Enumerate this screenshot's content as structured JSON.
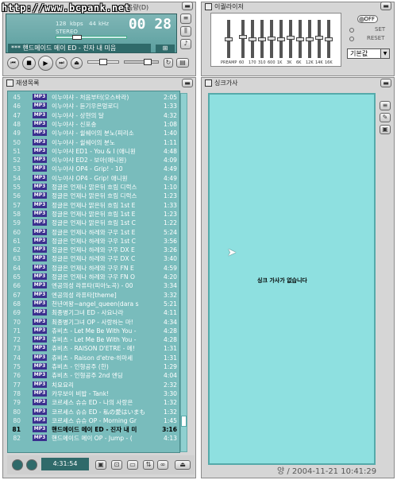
{
  "watermark": "http://www.bcpank.net",
  "player": {
    "title_suffix": "음량(D)",
    "bitrate": "128",
    "bitrate_unit": "kbps",
    "freq": "44",
    "freq_unit": "kHz",
    "mode": "STEREO",
    "time": "00 28",
    "track": "*** 핸드메이드 메이 ED - 진자 내 미음"
  },
  "eq": {
    "title": "이퀄라이저",
    "off_label": "OFF",
    "set_label": "SET",
    "reset_label": "RESET",
    "preset": "기본값",
    "preamp_label": "PREAMP",
    "bands": [
      "60",
      "170",
      "310",
      "600",
      "1K",
      "3K",
      "6K",
      "12K",
      "14K",
      "16K"
    ],
    "levels": [
      0.5,
      0.45,
      0.5,
      0.52,
      0.48,
      0.5,
      0.47,
      0.5,
      0.5,
      0.46,
      0.5
    ]
  },
  "playlist": {
    "title": "재생목록",
    "total_time": "4:31:54",
    "rows": [
      {
        "n": "45",
        "t": "이누야샤 - 처음부터(오스바라)",
        "d": "2:05"
      },
      {
        "n": "46",
        "t": "이누야샤 - 듣기우은멍로디",
        "d": "1:33"
      },
      {
        "n": "47",
        "t": "이누야샤 - 상현의 달",
        "d": "4:32"
      },
      {
        "n": "48",
        "t": "이누야샤 - 신포송",
        "d": "1:08"
      },
      {
        "n": "49",
        "t": "이누야샤 - 쉴쉐이의 분노(피리소",
        "d": "1:40"
      },
      {
        "n": "50",
        "t": "이누야샤 - 쉴쉐이의 분노",
        "d": "1:11"
      },
      {
        "n": "51",
        "t": "이누야샤 ED1 - You & I (애니원",
        "d": "4:48"
      },
      {
        "n": "52",
        "t": "이누야샤 ED2 - 보아(애니원)",
        "d": "4:09"
      },
      {
        "n": "53",
        "t": "이누야샤 OP4 - Grip! - 10",
        "d": "4:49"
      },
      {
        "n": "54",
        "t": "이누야샤 OP4 - Grip! 애니원",
        "d": "4:49"
      },
      {
        "n": "55",
        "t": "정글은 언제나 맑은뒤 흐림 디럭스",
        "d": "1:10"
      },
      {
        "n": "56",
        "t": "정글은 언제나 맑은뒤 흐림 디럭스",
        "d": "1:23"
      },
      {
        "n": "57",
        "t": "정글은 언제나 맑은뒤 흐림 1st E",
        "d": "1:33"
      },
      {
        "n": "58",
        "t": "정글은 언제나 맑은뒤 흐림 1st E",
        "d": "1:23"
      },
      {
        "n": "59",
        "t": "정글은 언제나 맑은뒤 흐림 1st C",
        "d": "1:22"
      },
      {
        "n": "60",
        "t": "정글은 언제나 하레와 구우 1st E",
        "d": "5:24"
      },
      {
        "n": "61",
        "t": "정글은 언제나 하레와 구우 1st C",
        "d": "3:56"
      },
      {
        "n": "62",
        "t": "정글은 언제나 하레와 구우 DX E",
        "d": "3:26"
      },
      {
        "n": "63",
        "t": "정글은 언제나 하레와 구우 DX C",
        "d": "3:40"
      },
      {
        "n": "64",
        "t": "정글은 언제나 하레와 구우 FN E",
        "d": "4:59"
      },
      {
        "n": "65",
        "t": "정글은 언제나 하레와 구우 FN O",
        "d": "4:20"
      },
      {
        "n": "66",
        "t": "엔공의성 라퓨타(피아노곡) - 00",
        "d": "3:34"
      },
      {
        "n": "67",
        "t": "엔공의성 라퓨타[theme]",
        "d": "3:32"
      },
      {
        "n": "68",
        "t": "천년여왕~angel_queen(dara s",
        "d": "5:21"
      },
      {
        "n": "69",
        "t": "최종병기그녀 ED - 사요나라",
        "d": "4:11"
      },
      {
        "n": "70",
        "t": "최종병기그녀 OP - 사랑하는 마!",
        "d": "4:34"
      },
      {
        "n": "71",
        "t": "츄비츠 - Let Me Be With You -",
        "d": "4:28"
      },
      {
        "n": "72",
        "t": "츄비츠 - Let Me Be With You -",
        "d": "4:28"
      },
      {
        "n": "73",
        "t": "츄비츠 - RAISON D'ETRE - 메!",
        "d": "1:31"
      },
      {
        "n": "74",
        "t": "츄비츠 - Raison d'etre-히마세",
        "d": "1:31"
      },
      {
        "n": "75",
        "t": "츄비츠 - 인형공주 (한)",
        "d": "1:29"
      },
      {
        "n": "76",
        "t": "츄비츠 - 인형공주 2nd 엔딩",
        "d": "4:04"
      },
      {
        "n": "77",
        "t": "치요요리",
        "d": "2:32"
      },
      {
        "n": "78",
        "t": "카우보이 비밥 - Tank!",
        "d": "3:30"
      },
      {
        "n": "79",
        "t": "코르세스 슈슈 ED - 나의 사랑은",
        "d": "1:32"
      },
      {
        "n": "80",
        "t": "코르세스 슈슈 ED - 私の愛はいまも",
        "d": "1:32"
      },
      {
        "n": "80",
        "t": "코르세스 슈슈 OP - Morning Gr",
        "d": "1:45"
      },
      {
        "n": "81",
        "t": "핸드메이드 메이 ED - 진자 내 미",
        "d": "3:16"
      },
      {
        "n": "82",
        "t": "핸드메이드 메이 OP - Jump - (",
        "d": "4:13"
      }
    ],
    "tag": "MP3",
    "selected_index": 37
  },
  "lyrics": {
    "title": "싱크가사",
    "message": "싱크 가사가 없습니다"
  },
  "datestamp": "양 / 2004-11-21 10:41:29"
}
